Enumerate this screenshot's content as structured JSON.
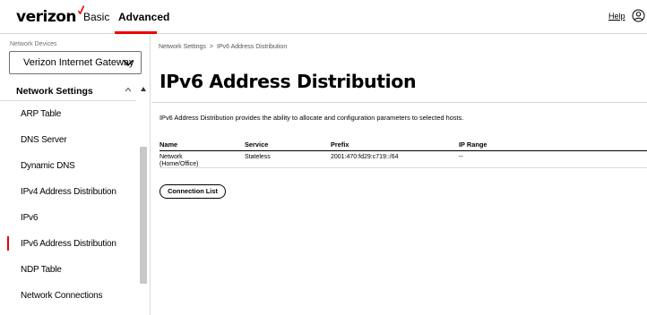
{
  "header": {
    "logo": "verizon",
    "tabs": [
      {
        "label": "Basic"
      },
      {
        "label": "Advanced"
      }
    ],
    "help_label": "Help",
    "accent_color": "#ee0000"
  },
  "sidebar": {
    "devices_label": "Network Devices",
    "device_selected": "Verizon Internet Gateway",
    "section_title": "Network Settings",
    "items": [
      {
        "label": "ARP Table"
      },
      {
        "label": "DNS Server"
      },
      {
        "label": "Dynamic DNS"
      },
      {
        "label": "IPv4 Address Distribution"
      },
      {
        "label": "IPv6"
      },
      {
        "label": "IPv6 Address Distribution",
        "active": true
      },
      {
        "label": "NDP Table"
      },
      {
        "label": "Network Connections"
      }
    ]
  },
  "main": {
    "breadcrumb": [
      "Network Settings",
      ">",
      "IPv6 Address Distribution"
    ],
    "title": "IPv6 Address Distribution",
    "description": "IPv6 Address Distribution provides the ability to allocate and configuration parameters to selected hosts.",
    "table": {
      "headers": [
        "Name",
        "Service",
        "Prefix",
        "IP Range"
      ],
      "rows": [
        [
          "Network (Home/Office)",
          "Stateless",
          "2001:470:fd29:c719::/64",
          "--"
        ]
      ]
    },
    "connection_list_button": "Connection List"
  }
}
